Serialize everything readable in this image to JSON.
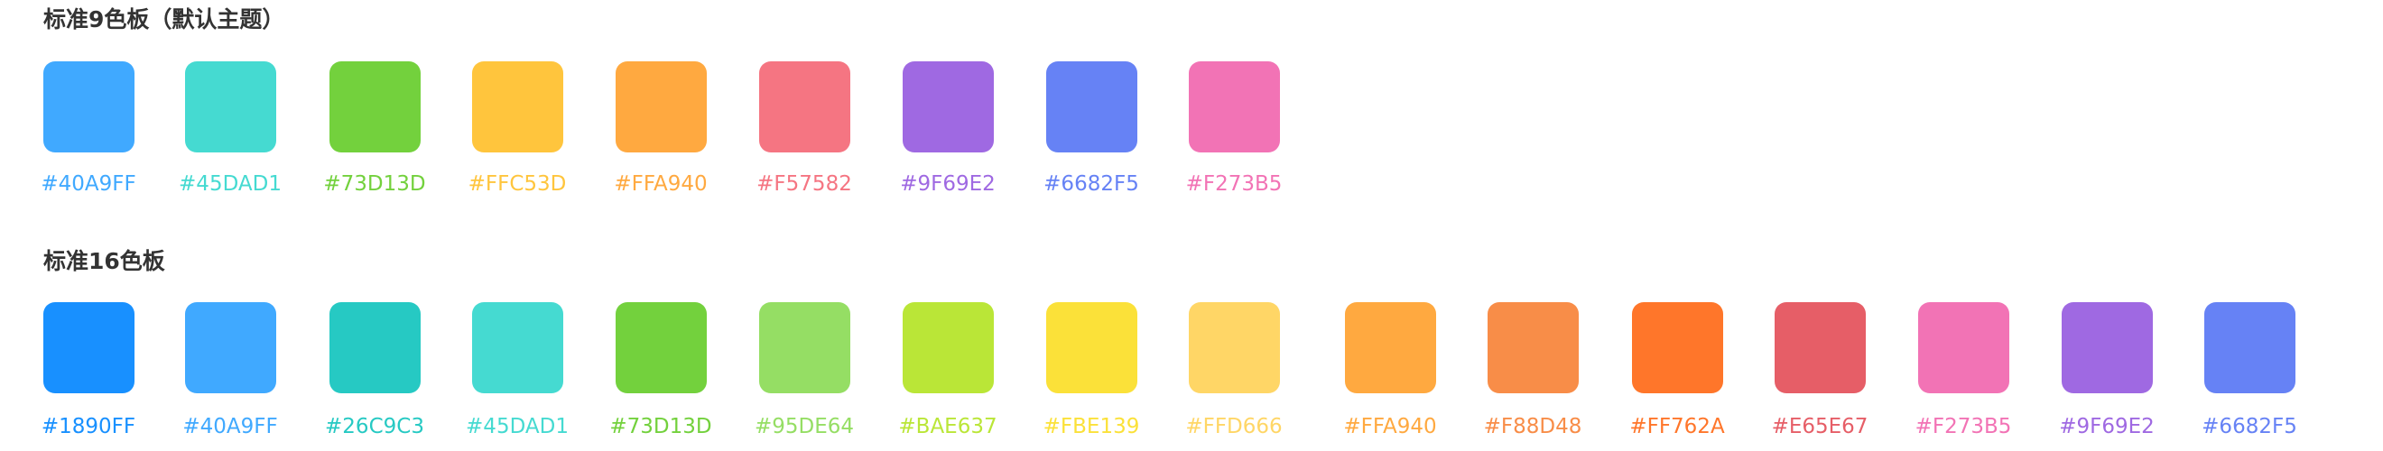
{
  "palette9": {
    "title": "标准9色板（默认主题）",
    "colors": [
      "#40A9FF",
      "#45DAD1",
      "#73D13D",
      "#FFC53D",
      "#FFA940",
      "#F57582",
      "#9F69E2",
      "#6682F5",
      "#F273B5"
    ]
  },
  "palette16": {
    "title": "标准16色板",
    "colors": [
      "#1890FF",
      "#40A9FF",
      "#26C9C3",
      "#45DAD1",
      "#73D13D",
      "#95DE64",
      "#BAE637",
      "#FBE139",
      "#FFD666",
      "#FFA940",
      "#F88D48",
      "#FF762A",
      "#E65E67",
      "#F273B5",
      "#9F69E2",
      "#6682F5"
    ]
  }
}
